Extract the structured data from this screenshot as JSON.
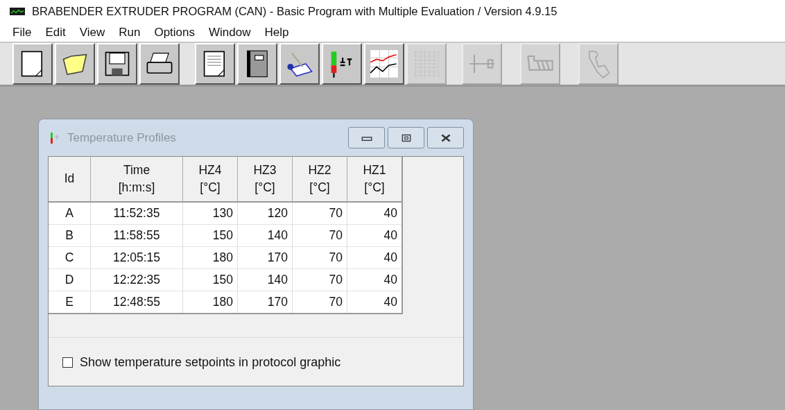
{
  "window": {
    "title": "BRABENDER EXTRUDER PROGRAM (CAN) - Basic Program with Multiple Evaluation / Version 4.9.15"
  },
  "menu": [
    "File",
    "Edit",
    "View",
    "Run",
    "Options",
    "Window",
    "Help"
  ],
  "toolbar": [
    [
      {
        "kind": "new",
        "disabled": false
      },
      {
        "kind": "open",
        "disabled": false
      },
      {
        "kind": "save",
        "disabled": false
      },
      {
        "kind": "print",
        "disabled": false
      }
    ],
    [
      {
        "kind": "document",
        "disabled": false
      },
      {
        "kind": "notebook",
        "disabled": false
      },
      {
        "kind": "writing",
        "disabled": false
      },
      {
        "kind": "thermometer",
        "disabled": false
      },
      {
        "kind": "chart",
        "disabled": false
      },
      {
        "kind": "grid",
        "disabled": true
      }
    ],
    [
      {
        "kind": "screw",
        "disabled": true
      },
      {
        "kind": "barrel",
        "disabled": true
      },
      {
        "kind": "hand",
        "disabled": true
      }
    ]
  ],
  "child_window": {
    "title": "Temperature Profiles",
    "table": {
      "columns": [
        {
          "name": "Id"
        },
        {
          "name": "Time",
          "unit": "[h:m:s]"
        },
        {
          "name": "HZ4",
          "unit": "[°C]"
        },
        {
          "name": "HZ3",
          "unit": "[°C]"
        },
        {
          "name": "HZ2",
          "unit": "[°C]"
        },
        {
          "name": "HZ1",
          "unit": "[°C]"
        }
      ],
      "rows": [
        [
          "A",
          "11:52:35",
          "130",
          "120",
          "70",
          "40"
        ],
        [
          "B",
          "11:58:55",
          "150",
          "140",
          "70",
          "40"
        ],
        [
          "C",
          "12:05:15",
          "180",
          "170",
          "70",
          "40"
        ],
        [
          "D",
          "12:22:35",
          "150",
          "140",
          "70",
          "40"
        ],
        [
          "E",
          "12:48:55",
          "180",
          "170",
          "70",
          "40"
        ]
      ]
    },
    "checkbox": {
      "label": "Show temperature setpoints in protocol graphic",
      "checked": false
    }
  }
}
